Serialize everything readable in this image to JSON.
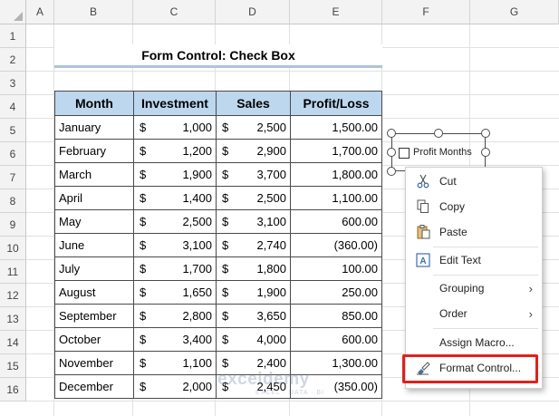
{
  "columns": [
    "A",
    "B",
    "C",
    "D",
    "E",
    "F",
    "G"
  ],
  "rows": [
    "1",
    "2",
    "3",
    "4",
    "5",
    "6",
    "7",
    "8",
    "9",
    "10",
    "11",
    "12",
    "13",
    "14",
    "15",
    "16"
  ],
  "title": "Form Control: Check Box",
  "table": {
    "headers": [
      "Month",
      "Investment",
      "Sales",
      "Profit/Loss"
    ],
    "currency": "$",
    "rows": [
      {
        "month": "January",
        "investment": "1,000",
        "sales": "2,500",
        "pl": "1,500.00"
      },
      {
        "month": "February",
        "investment": "1,200",
        "sales": "2,900",
        "pl": "1,700.00"
      },
      {
        "month": "March",
        "investment": "1,900",
        "sales": "3,700",
        "pl": "1,800.00"
      },
      {
        "month": "April",
        "investment": "1,400",
        "sales": "2,500",
        "pl": "1,100.00"
      },
      {
        "month": "May",
        "investment": "2,500",
        "sales": "3,100",
        "pl": "600.00"
      },
      {
        "month": "June",
        "investment": "3,100",
        "sales": "2,740",
        "pl": "(360.00)"
      },
      {
        "month": "July",
        "investment": "1,700",
        "sales": "1,800",
        "pl": "100.00"
      },
      {
        "month": "August",
        "investment": "1,650",
        "sales": "1,900",
        "pl": "250.00"
      },
      {
        "month": "September",
        "investment": "2,800",
        "sales": "3,650",
        "pl": "850.00"
      },
      {
        "month": "October",
        "investment": "3,400",
        "sales": "4,000",
        "pl": "600.00"
      },
      {
        "month": "November",
        "investment": "1,100",
        "sales": "2,400",
        "pl": "1,300.00"
      },
      {
        "month": "December",
        "investment": "2,000",
        "sales": "2,450",
        "pl": "(350.00)"
      }
    ]
  },
  "checkbox": {
    "label": "Profit Months",
    "checked": false
  },
  "context_menu": {
    "items": [
      {
        "label": "Cut",
        "icon": "scissors-icon"
      },
      {
        "label": "Copy",
        "icon": "copy-icon"
      },
      {
        "label": "Paste",
        "icon": "paste-icon"
      },
      {
        "label": "Edit Text",
        "icon": "edit-text-icon"
      },
      {
        "label": "Grouping",
        "icon": "",
        "submenu": true
      },
      {
        "label": "Order",
        "icon": "",
        "submenu": true
      },
      {
        "label": "Assign Macro...",
        "icon": ""
      },
      {
        "label": "Format Control...",
        "icon": "format-control-icon"
      }
    ]
  },
  "watermark": {
    "brand": "exceldemy",
    "tagline": "EXCEL · DATA · BI"
  },
  "colors": {
    "header_fill": "#bdd7ee",
    "title_underline": "#aec3de",
    "highlight_border": "#e0211b"
  }
}
